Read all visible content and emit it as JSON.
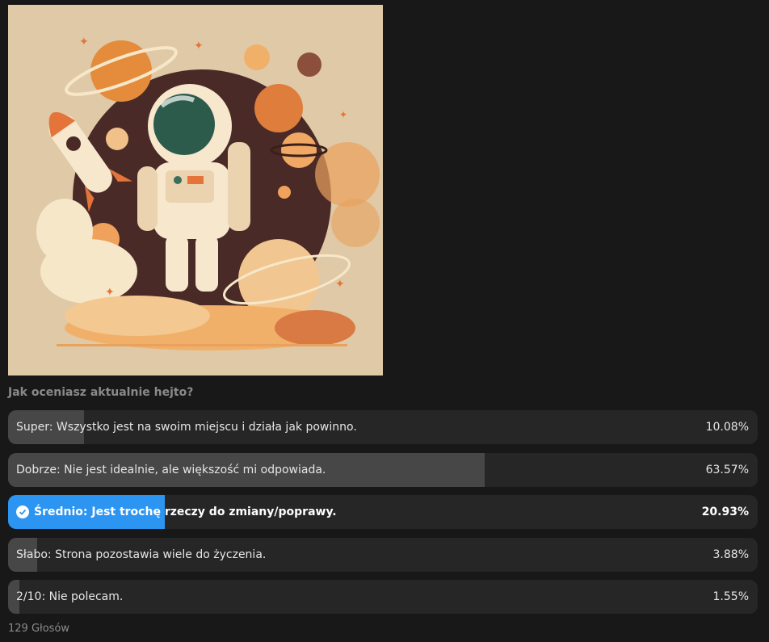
{
  "poll": {
    "question": "Jak oceniasz aktualnie hejto?",
    "options": [
      {
        "label": "Super: Wszystko jest na swoim miejscu i działa jak powinno.",
        "percent_text": "10.08%",
        "percent": 10.08,
        "selected": false
      },
      {
        "label": "Dobrze: Nie jest idealnie, ale większość mi odpowiada.",
        "percent_text": "63.57%",
        "percent": 63.57,
        "selected": false
      },
      {
        "label": "Średnio: Jest trochę rzeczy do zmiany/poprawy.",
        "percent_text": "20.93%",
        "percent": 20.93,
        "selected": true
      },
      {
        "label": "Słabo: Strona pozostawia wiele do życzenia.",
        "percent_text": "3.88%",
        "percent": 3.88,
        "selected": false
      },
      {
        "label": "2/10: Nie polecam.",
        "percent_text": "1.55%",
        "percent": 1.55,
        "selected": false
      }
    ],
    "votes_text": "129 Głosów"
  },
  "colors": {
    "background": "#181818",
    "option_bg": "#262626",
    "option_fill": "#474747",
    "selected_fill": "#2c95f2",
    "illustration_bg": "#dfc9a6"
  }
}
